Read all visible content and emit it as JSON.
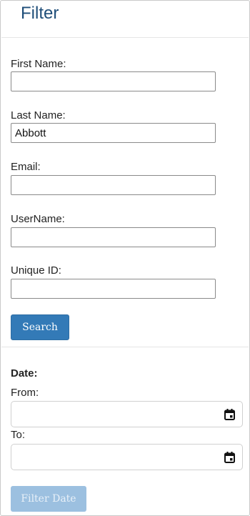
{
  "header": {
    "title": "Filter"
  },
  "form": {
    "first_name": {
      "label": "First Name:",
      "value": ""
    },
    "last_name": {
      "label": "Last Name:",
      "value": "Abbott"
    },
    "email": {
      "label": "Email:",
      "value": ""
    },
    "username": {
      "label": "UserName:",
      "value": ""
    },
    "unique_id": {
      "label": "Unique ID:",
      "value": ""
    },
    "search_label": "Search"
  },
  "date_filter": {
    "heading": "Date:",
    "from_label": "From:",
    "to_label": "To:",
    "filter_label": "Filter Date",
    "icon": "calendar-icon"
  },
  "colors": {
    "title": "#1f4e79",
    "primary_button": "#337ab7",
    "disabled_button": "#9cc0e0"
  }
}
